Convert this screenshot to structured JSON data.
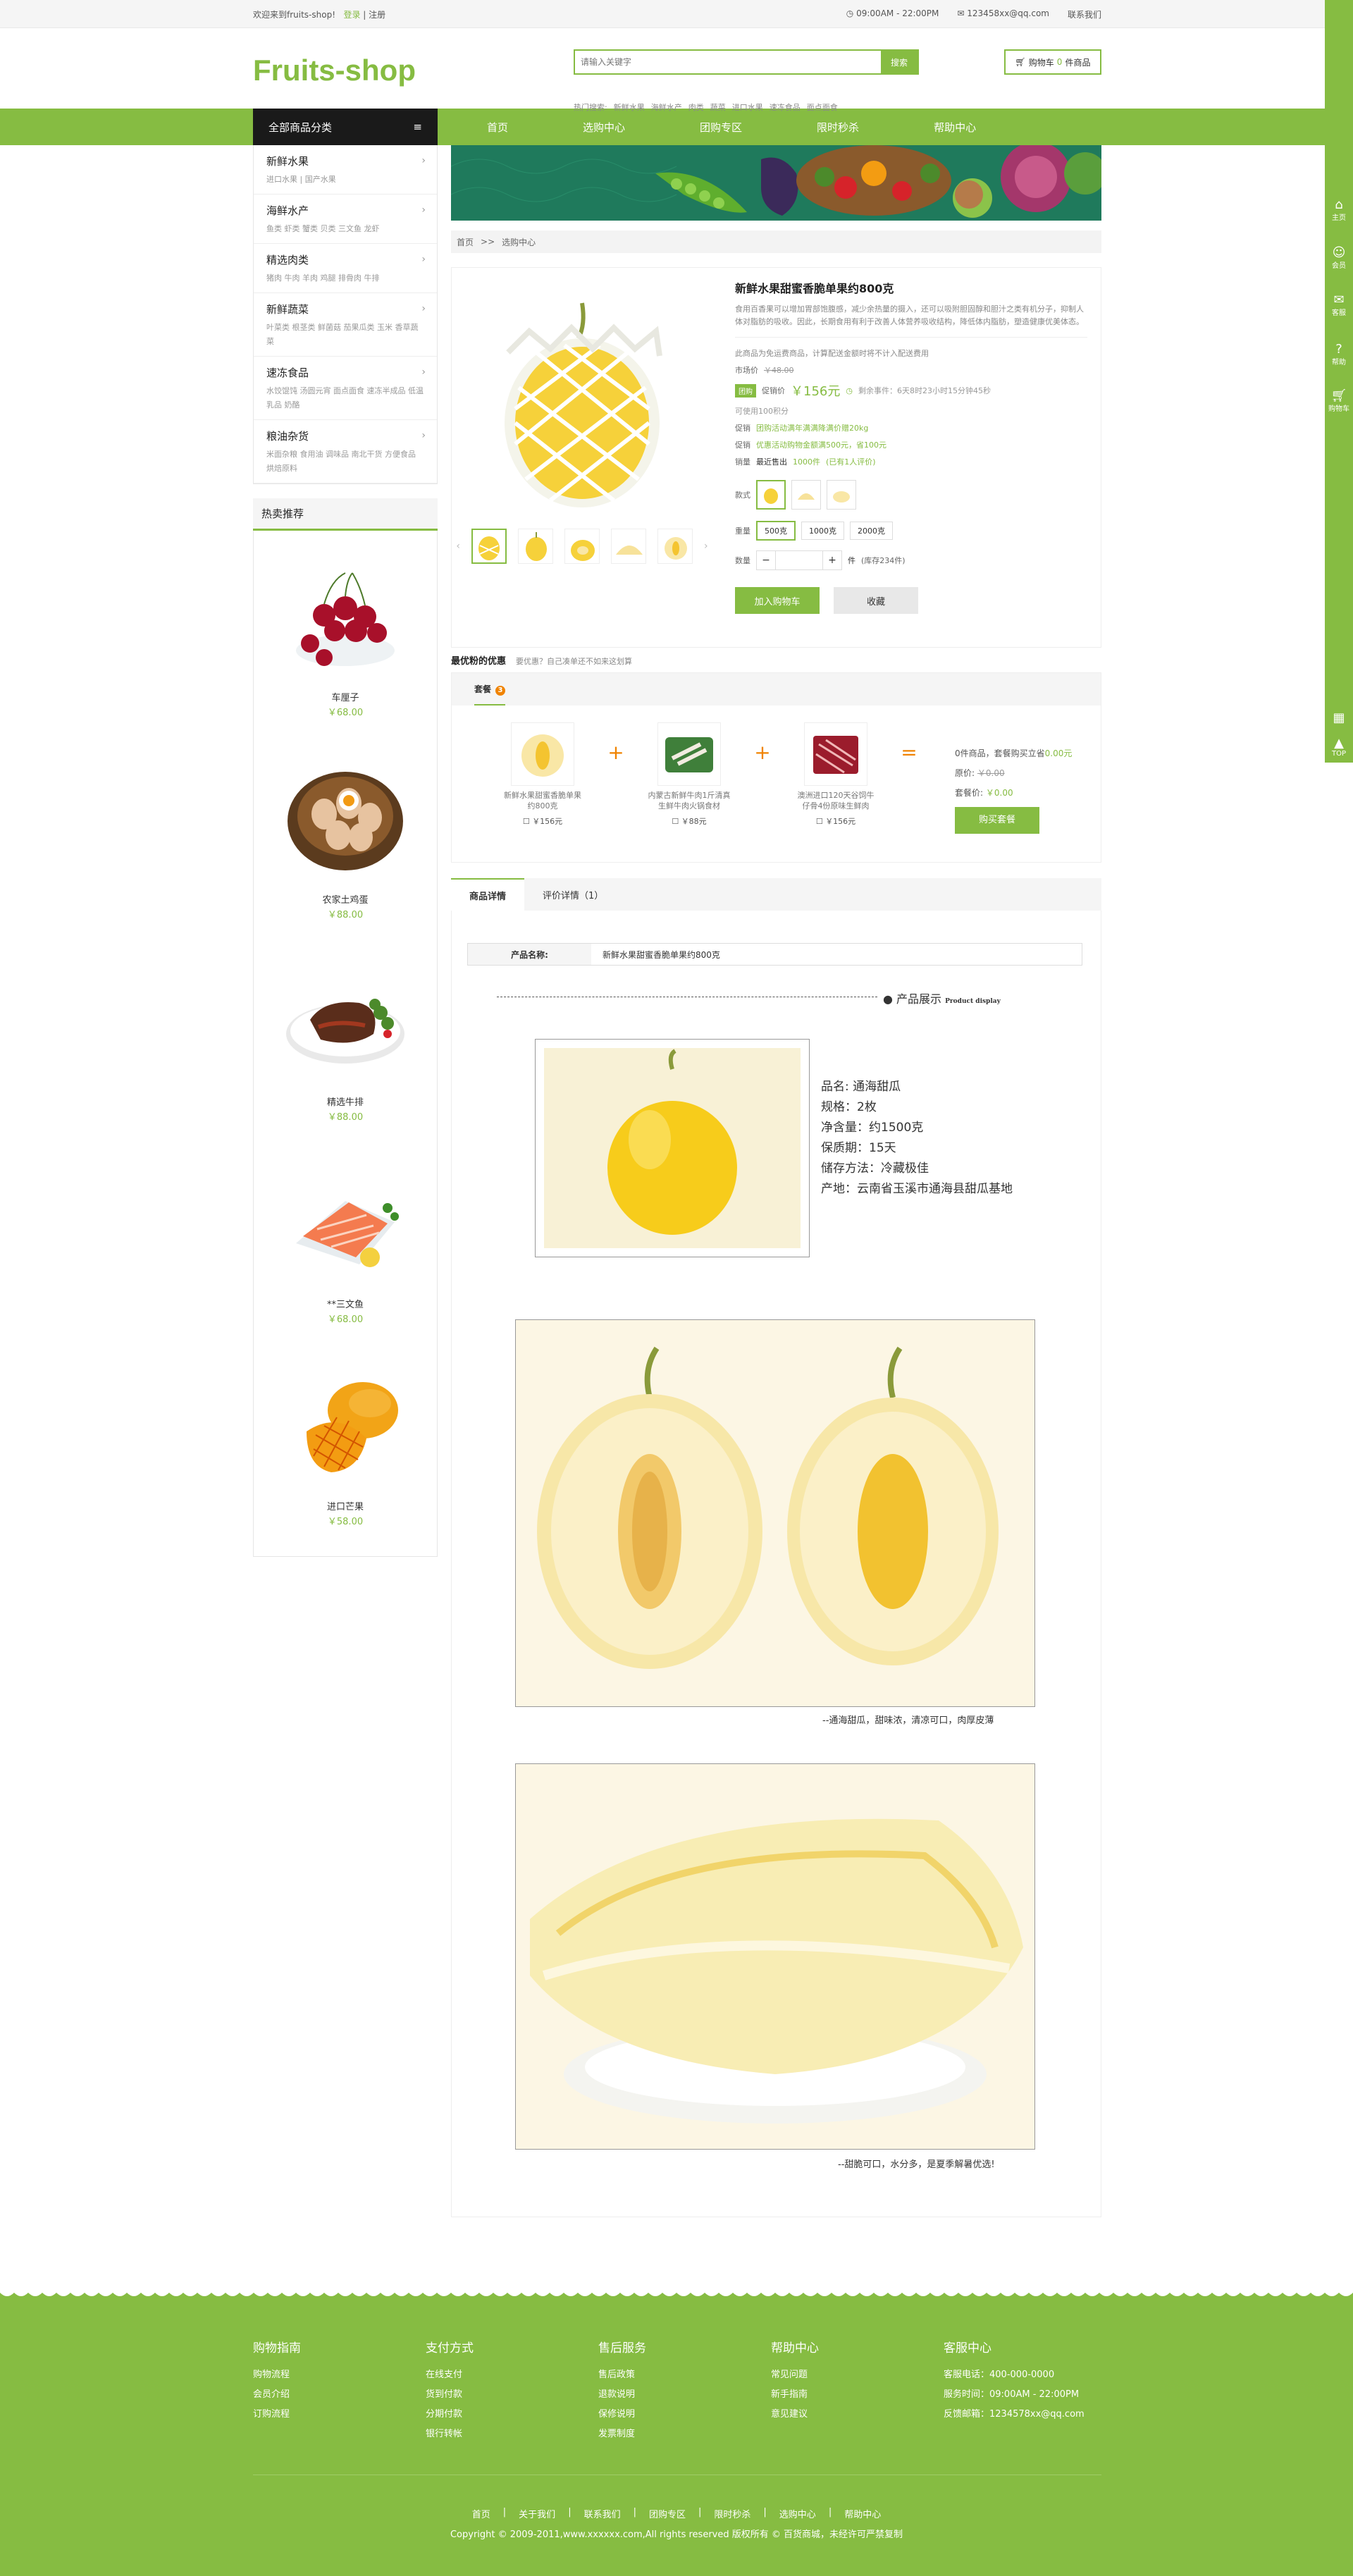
{
  "topbar": {
    "welcome": "欢迎来到fruits-shop!",
    "login": "登录",
    "register": "注册",
    "hours": "09:00AM - 22:00PM",
    "email": "123458xx@qq.com",
    "contact": "联系我们"
  },
  "header": {
    "logo": "Fruits-shop",
    "search_placeholder": "请输入关键字",
    "search_btn": "搜索",
    "hot_label": "热门搜索:",
    "hot": [
      "新鲜水果",
      "海鲜水产",
      "肉类",
      "蔬菜",
      "进口水果",
      "速冻食品",
      "面点面食"
    ],
    "cart_label": "购物车",
    "cart_count": "0",
    "cart_unit": "件商品"
  },
  "nav": {
    "all": "全部商品分类",
    "items": [
      "首页",
      "选购中心",
      "团购专区",
      "限时秒杀",
      "帮助中心"
    ]
  },
  "categories": [
    {
      "title": "新鲜水果",
      "sub": "进口水果 | 国产水果"
    },
    {
      "title": "海鲜水产",
      "sub": "鱼类  虾类  蟹类  贝类  三文鱼  龙虾"
    },
    {
      "title": "精选肉类",
      "sub": "猪肉  牛肉  羊肉  鸡腿  排骨肉  牛排"
    },
    {
      "title": "新鲜蔬菜",
      "sub": "叶菜类  根茎类  鲜菌菇  茄果瓜类  玉米  香草蔬菜"
    },
    {
      "title": "速冻食品",
      "sub": "水饺馄饨  汤圆元宵  面点面食  速冻半成品  低温乳品  奶酪"
    },
    {
      "title": "粮油杂货",
      "sub": "米面杂粮  食用油  调味品  南北干货  方便食品  烘焙原料"
    }
  ],
  "hot": {
    "title": "热卖推荐",
    "items": [
      {
        "name": "车厘子",
        "price": "￥68.00"
      },
      {
        "name": "农家土鸡蛋",
        "price": "￥88.00"
      },
      {
        "name": "精选牛排",
        "price": "￥88.00"
      },
      {
        "name": "**三文鱼",
        "price": "￥68.00"
      },
      {
        "name": "进口芒果",
        "price": "￥58.00"
      }
    ]
  },
  "crumb": {
    "home": "首页",
    "sep": ">>",
    "current": "选购中心"
  },
  "product": {
    "title": "新鲜水果甜蜜香脆单果约800克",
    "desc": "食用百香果可以增加胃部饱腹感，减少余热量的摄入，还可以吸附胆固醇和胆汁之类有机分子，抑制人体对脂肪的吸收。因此，长期食用有利于改善人体营养吸收结构，降低体内脂肪，塑造健康优美体态。",
    "note": "此商品为免运费商品，计算配送金额时将不计入配送费用",
    "market_label": "市场价",
    "market_price": "￥48.00",
    "tuan": "团购",
    "promo_label": "促销价",
    "price": "￥156元",
    "countdown": "剩余事件：6天8时23小时15分钟45秒",
    "points": "可使用100积分",
    "promos": [
      {
        "label": "促销",
        "text": "团购活动满年满满降满价赠20kg"
      },
      {
        "label": "促销",
        "text": "优惠活动购物金额满500元，省100元"
      }
    ],
    "sales_label": "销量",
    "sales_pre": "最近售出",
    "sales_num": "1000件",
    "sales_eval": "(已有1人评价)",
    "style_label": "款式",
    "weight_label": "重量",
    "weights": [
      "500克",
      "1000克",
      "2000克"
    ],
    "qty_label": "数量",
    "qty_unit": "件",
    "stock": "(库存234件)",
    "add_cart": "加入购物车",
    "favorite": "收藏"
  },
  "combo": {
    "title": "最优粉的优惠",
    "subtitle": "要优惠？自己凑单还不如来这划算",
    "tab": "套餐",
    "tab_count": "3",
    "items": [
      {
        "name": "新鲜水果甜蜜香脆单果约800克",
        "price": "￥156元"
      },
      {
        "name": "内蒙古新鲜牛肉1斤清真生鲜牛肉火锅食材",
        "price": "￥88元"
      },
      {
        "name": "澳洲进口120天谷饲牛仔骨4份原味生鲜肉",
        "price": "￥156元"
      }
    ],
    "summary": "0件商品，套餐购买立省",
    "saved": "0.00元",
    "orig_label": "原价:",
    "orig": "￥0.00",
    "set_label": "套餐价:",
    "set_price": "￥0.00",
    "buy": "购买套餐"
  },
  "details": {
    "tab1": "商品详情",
    "tab2": "评价详情",
    "tab2_count": "（1）",
    "pname_label": "产品名称:",
    "pname": "新鲜水果甜蜜香脆单果约800克",
    "showcase": "产品展示",
    "showcase_en": "Product display",
    "spec": [
      "品名: 通海甜瓜",
      "规格：2枚",
      "净含量：约1500克",
      "保质期：15天",
      "储存方法：冷藏极佳",
      "产地：云南省玉溪市通海县甜瓜基地"
    ],
    "caption1": "--通海甜瓜，甜味浓，清凉可口，肉厚皮薄",
    "caption2": "--甜脆可口，水分多，是夏季解暑优选!"
  },
  "footer": {
    "cols": [
      {
        "title": "购物指南",
        "items": [
          "购物流程",
          "会员介绍",
          "订购流程"
        ]
      },
      {
        "title": "支付方式",
        "items": [
          "在线支付",
          "货到付款",
          "分期付款",
          "银行转帐"
        ]
      },
      {
        "title": "售后服务",
        "items": [
          "售后政策",
          "退款说明",
          "保修说明",
          "发票制度"
        ]
      },
      {
        "title": "帮助中心",
        "items": [
          "常见问题",
          "新手指南",
          "意见建议"
        ]
      },
      {
        "title": "客服中心",
        "items": [
          "客服电话：400-000-0000",
          "服务时间：09:00AM - 22:00PM",
          "反馈邮箱：1234578xx@qq.com"
        ]
      }
    ],
    "links": [
      "首页",
      "关于我们",
      "联系我们",
      "团购专区",
      "限时秒杀",
      "选购中心",
      "帮助中心"
    ],
    "copyright": "Copyright © 2009-2011,www.xxxxxx.com,All rights reserved 版权所有 © 百货商城，未经许可严禁复制"
  },
  "rbar": [
    "主页",
    "会员",
    "客服",
    "帮助",
    "购物车",
    "TOP"
  ],
  "colors": {
    "accent": "#86bc42",
    "dark": "#1a1a1a",
    "orange": "#f08300"
  }
}
